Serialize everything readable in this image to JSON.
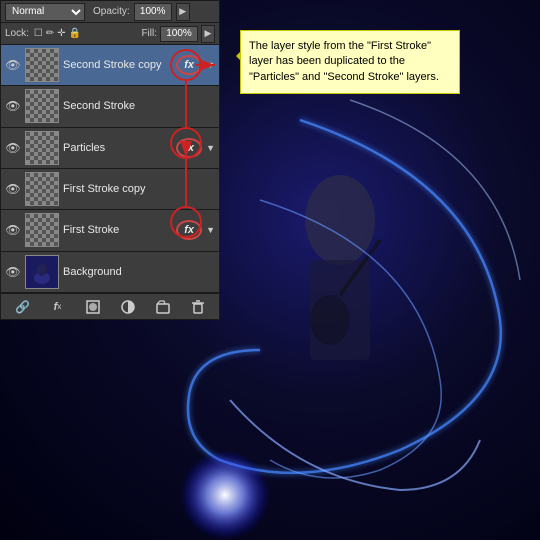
{
  "panel": {
    "blend_mode": "Normal",
    "opacity_label": "Opacity:",
    "opacity_value": "100%",
    "lock_label": "Lock:",
    "fill_label": "Fill:",
    "fill_value": "100%",
    "layers": [
      {
        "id": "second-stroke-copy",
        "name": "Second Stroke copy",
        "visible": true,
        "has_fx": true,
        "selected": true,
        "thumb_type": "transparent"
      },
      {
        "id": "second-stroke",
        "name": "Second Stroke",
        "visible": true,
        "has_fx": false,
        "selected": false,
        "thumb_type": "transparent"
      },
      {
        "id": "particles",
        "name": "Particles",
        "visible": true,
        "has_fx": true,
        "selected": false,
        "thumb_type": "transparent"
      },
      {
        "id": "first-stroke-copy",
        "name": "First Stroke copy",
        "visible": true,
        "has_fx": false,
        "selected": false,
        "thumb_type": "transparent"
      },
      {
        "id": "first-stroke",
        "name": "First Stroke",
        "visible": true,
        "has_fx": true,
        "selected": false,
        "thumb_type": "transparent"
      },
      {
        "id": "background",
        "name": "Background",
        "visible": true,
        "has_fx": false,
        "selected": false,
        "thumb_type": "bg"
      }
    ],
    "bottom_icons": [
      "link-icon",
      "fx-icon",
      "mask-icon",
      "adjustment-icon",
      "folder-icon",
      "trash-icon"
    ]
  },
  "callout": {
    "text": "The layer style from the \"First Stroke\" layer has been duplicated to the \"Particles\" and \"Second Stroke\" layers."
  },
  "icons": {
    "eye": "👁",
    "fx": "fx",
    "link": "🔗",
    "lock": "🔒",
    "lock_empty": "□",
    "brush": "✏",
    "move": "✛",
    "lock_px": "■"
  }
}
